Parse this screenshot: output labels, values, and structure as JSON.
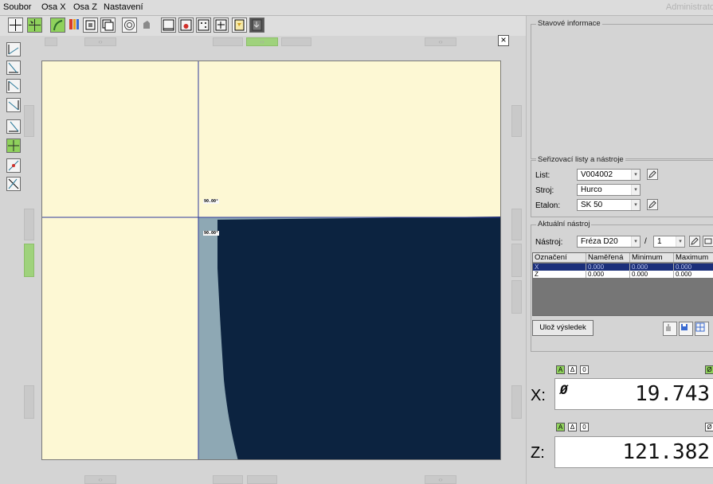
{
  "menu": {
    "items": [
      "Soubor",
      "Osa X",
      "Osa Z",
      "Nastavení"
    ],
    "user": "Administrato"
  },
  "toolbar": {
    "icons": [
      "crosshair-icon",
      "crosshair-move-icon",
      "profile-icon",
      "color-bars-icon",
      "window-icon",
      "window-stack-icon",
      "target-circle-icon",
      "eraser-icon",
      "frame-icon",
      "frame-red-icon",
      "frame-dots-icon",
      "frame-lines-icon",
      "dxf-import-icon",
      "dxf-export-icon"
    ]
  },
  "canvas": {
    "angle_labels": [
      "90.00°",
      "90.00°"
    ],
    "colors": {
      "background": "#fdf8d4",
      "tool_fill": "#0c2340",
      "tool_edge": "#8ea8b4",
      "crosshair": "#2f3a9c"
    }
  },
  "close_label": "×",
  "status": {
    "title": "Stavové informace"
  },
  "sheets": {
    "title": "Seřizovací listy a nástroje",
    "list_label": "List:",
    "list_value": "V004002",
    "machine_label": "Stroj:",
    "machine_value": "Hurco",
    "etalon_label": "Etalon:",
    "etalon_value": "SK 50"
  },
  "current_tool": {
    "title": "Aktuální nástroj",
    "tool_label": "Nástroj:",
    "tool_value": "Fréza D20",
    "separator": "/",
    "index_value": "1"
  },
  "table": {
    "columns": [
      "Označení",
      "Naměřená",
      "Minimum",
      "Maximum"
    ],
    "rows": [
      {
        "name": "X",
        "measured": "0.000",
        "min": "0.000",
        "max": "0.000"
      },
      {
        "name": "Z",
        "measured": "0.000",
        "min": "0.000",
        "max": "0.000"
      }
    ]
  },
  "save_label": "Ulož výsledek",
  "axes": {
    "flags": [
      "A",
      "Δ",
      "0"
    ],
    "diameter_flag": "Ø",
    "x_label": "X:",
    "x_value": "19.743",
    "x_diameter": "Ø",
    "z_label": "Z:",
    "z_value": "121.382"
  },
  "ghost_arrow": "‹›"
}
